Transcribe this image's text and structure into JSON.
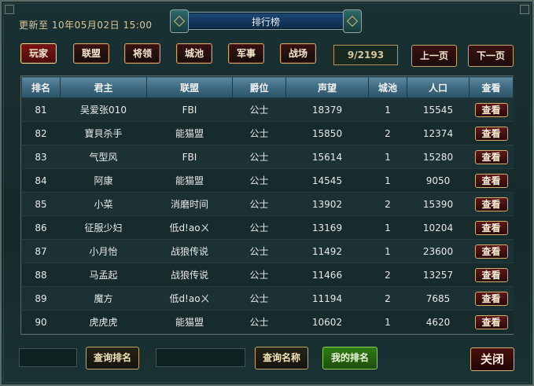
{
  "header": {
    "update_text": "更新至 10年05月02日 15:00",
    "title": "排行榜"
  },
  "tabs": [
    {
      "label": "玩家",
      "active": true
    },
    {
      "label": "联盟",
      "active": false
    },
    {
      "label": "将领",
      "active": false
    },
    {
      "label": "城池",
      "active": false
    },
    {
      "label": "军事",
      "active": false
    },
    {
      "label": "战场",
      "active": false
    }
  ],
  "pagination": {
    "page_info": "9/2193",
    "prev_label": "上一页",
    "next_label": "下一页"
  },
  "table": {
    "columns": [
      "排名",
      "君主",
      "联盟",
      "爵位",
      "声望",
      "城池",
      "人口",
      "查看"
    ],
    "view_label": "查看",
    "rows": [
      [
        "81",
        "吴爱张010",
        "FBI",
        "公士",
        "18379",
        "1",
        "15545"
      ],
      [
        "82",
        "寶貝杀手",
        "能猫盟",
        "公士",
        "15850",
        "2",
        "12374"
      ],
      [
        "83",
        "气型风",
        "FBI",
        "公士",
        "15614",
        "1",
        "15280"
      ],
      [
        "84",
        "阿康",
        "能猫盟",
        "公士",
        "14545",
        "1",
        "9050"
      ],
      [
        "85",
        "小菜",
        "消磨时间",
        "公士",
        "13902",
        "2",
        "15390"
      ],
      [
        "86",
        "征服少妇",
        "低d!aoㄨ",
        "公士",
        "13169",
        "1",
        "10204"
      ],
      [
        "87",
        "小月怡",
        "战狼传说",
        "公士",
        "11492",
        "1",
        "23600"
      ],
      [
        "88",
        "马孟起",
        "战狼传说",
        "公士",
        "11466",
        "2",
        "13257"
      ],
      [
        "89",
        "魔方",
        "低d!aoㄨ",
        "公士",
        "11194",
        "2",
        "7685"
      ],
      [
        "90",
        "虎虎虎",
        "能猫盟",
        "公士",
        "10602",
        "1",
        "4620"
      ]
    ]
  },
  "footer": {
    "rank_input_value": "",
    "query_rank_label": "查询排名",
    "name_input_value": "",
    "query_name_label": "查询名称",
    "my_rank_label": "我的排名",
    "close_label": "关闭"
  },
  "colors": {
    "accent_gold": "#caa36a",
    "header_blue": "#3f6d84",
    "button_red": "#4a0d0d",
    "button_green": "#2f7d13"
  }
}
